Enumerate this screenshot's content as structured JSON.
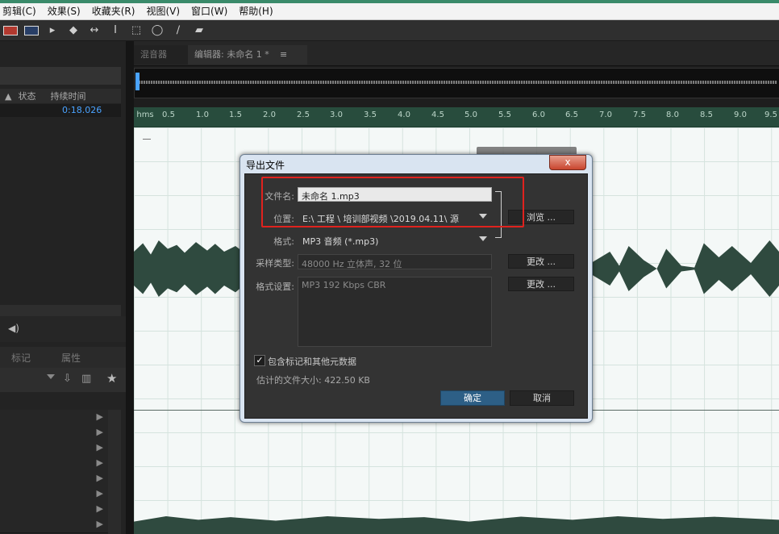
{
  "menubar": {
    "items": [
      "剪辑(C)",
      "效果(S)",
      "收藏夹(R)",
      "视图(V)",
      "窗口(W)",
      "帮助(H)"
    ]
  },
  "toolbar": {
    "tools": [
      "waveform-spectral-icon",
      "frequency-icon",
      "move-icon",
      "razor-icon",
      "slip-icon",
      "time-select-icon",
      "marquee-icon",
      "lasso-icon",
      "brush-icon",
      "spot-heal-icon"
    ]
  },
  "files_panel": {
    "columns": {
      "status": "状态",
      "duration": "持续时间"
    },
    "row": {
      "duration": "0:18.026"
    }
  },
  "markers_panel": {
    "tabs": {
      "markers": "标记",
      "properties": "属性"
    }
  },
  "editor": {
    "tabs": {
      "mixer": "混音器",
      "editor": "编辑器: 未命名 1 *"
    },
    "ruler": {
      "unit": "hms",
      "ticks": [
        "0.5",
        "1.0",
        "1.5",
        "2.0",
        "2.5",
        "3.0",
        "3.5",
        "4.0",
        "4.5",
        "5.0",
        "5.5",
        "6.0",
        "6.5",
        "7.0",
        "7.5",
        "8.0",
        "8.5",
        "9.0",
        "9.5"
      ]
    }
  },
  "dialog": {
    "title": "导出文件",
    "close": "x",
    "filename": {
      "label": "文件名:",
      "value": "未命名 1.mp3"
    },
    "location": {
      "label": "位置:",
      "value": "E:\\ 工程 \\ 培训部视频 \\2019.04.11\\ 源",
      "browse": "浏览 ..."
    },
    "format": {
      "label": "格式:",
      "value": "MP3 音频 (*.mp3)"
    },
    "sample_type": {
      "label": "采样类型:",
      "value": "48000 Hz 立体声, 32 位",
      "change": "更改 ..."
    },
    "format_settings": {
      "label": "格式设置:",
      "value": "MP3 192 Kbps CBR",
      "change": "更改 ..."
    },
    "include_markers": {
      "label": "包含标记和其他元数据",
      "checked": true,
      "mark": "✓"
    },
    "estimated_size": "估计的文件大小: 422.50 KB",
    "ok": "确定",
    "cancel": "取消"
  }
}
